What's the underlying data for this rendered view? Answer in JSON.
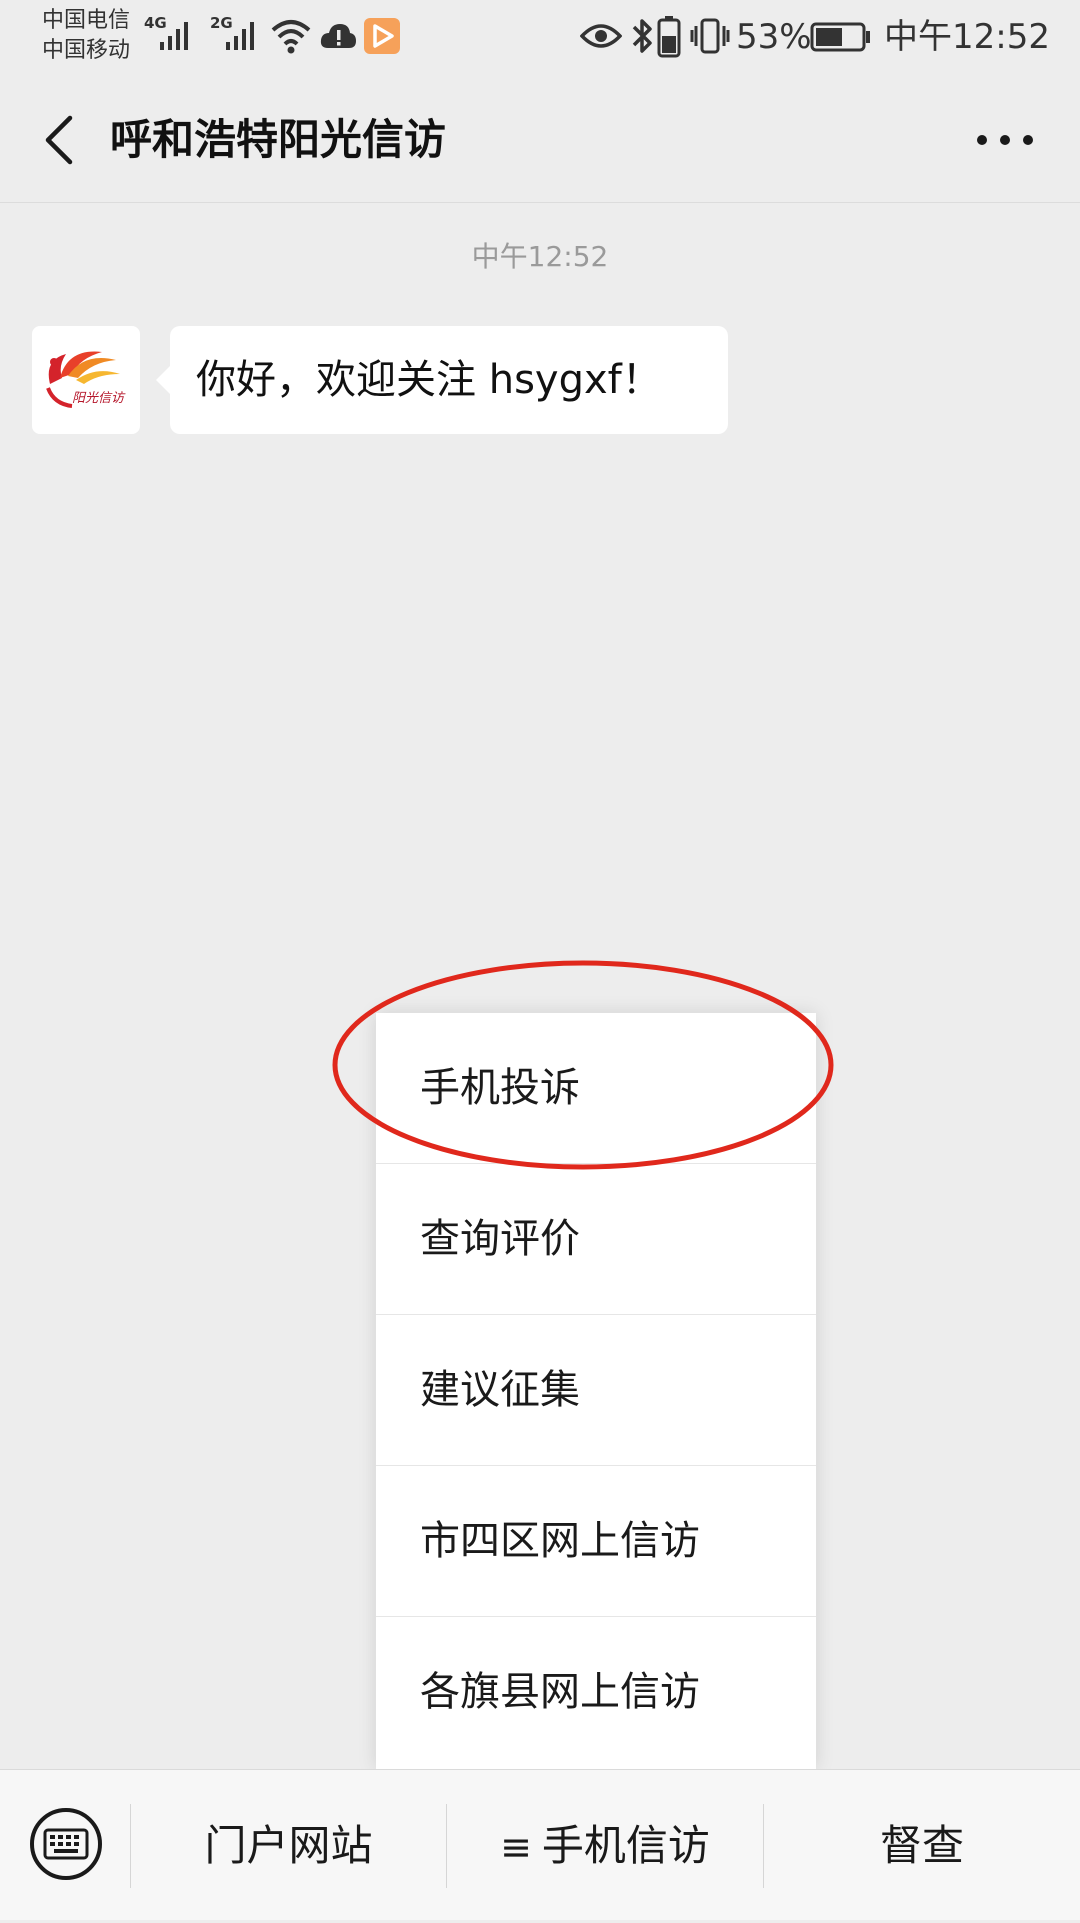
{
  "status_bar": {
    "carrier_1": "中国电信",
    "carrier_2": "中国移动",
    "network_1": "4G",
    "network_2": "2G",
    "battery_percent": "53%",
    "time": "中午12:52",
    "icons": [
      "signal-icon",
      "wifi-icon",
      "cloud-alert-icon",
      "media-app-icon",
      "eye-icon",
      "bluetooth-icon",
      "battery-charging-icon",
      "vibrate-icon",
      "battery-icon"
    ]
  },
  "header": {
    "title": "呼和浩特阳光信访",
    "back_icon": "chevron-left-icon",
    "more_icon": "more-dots-icon"
  },
  "chat": {
    "timestamp": "中午12:52",
    "message": "你好，欢迎关注 hsygxf！",
    "avatar_text": "阳光信访"
  },
  "submenu": {
    "items": [
      {
        "label": "手机投诉"
      },
      {
        "label": "查询评价"
      },
      {
        "label": "建议征集"
      },
      {
        "label": "市四区网上信访"
      },
      {
        "label": "各旗县网上信访"
      }
    ],
    "highlight_color": "#e0281c"
  },
  "bottom_menu": {
    "keyboard_icon": "keyboard-icon",
    "tab_1": "门户网站",
    "tab_2_icon": "≡",
    "tab_2": "手机信访",
    "tab_3": "督查"
  }
}
